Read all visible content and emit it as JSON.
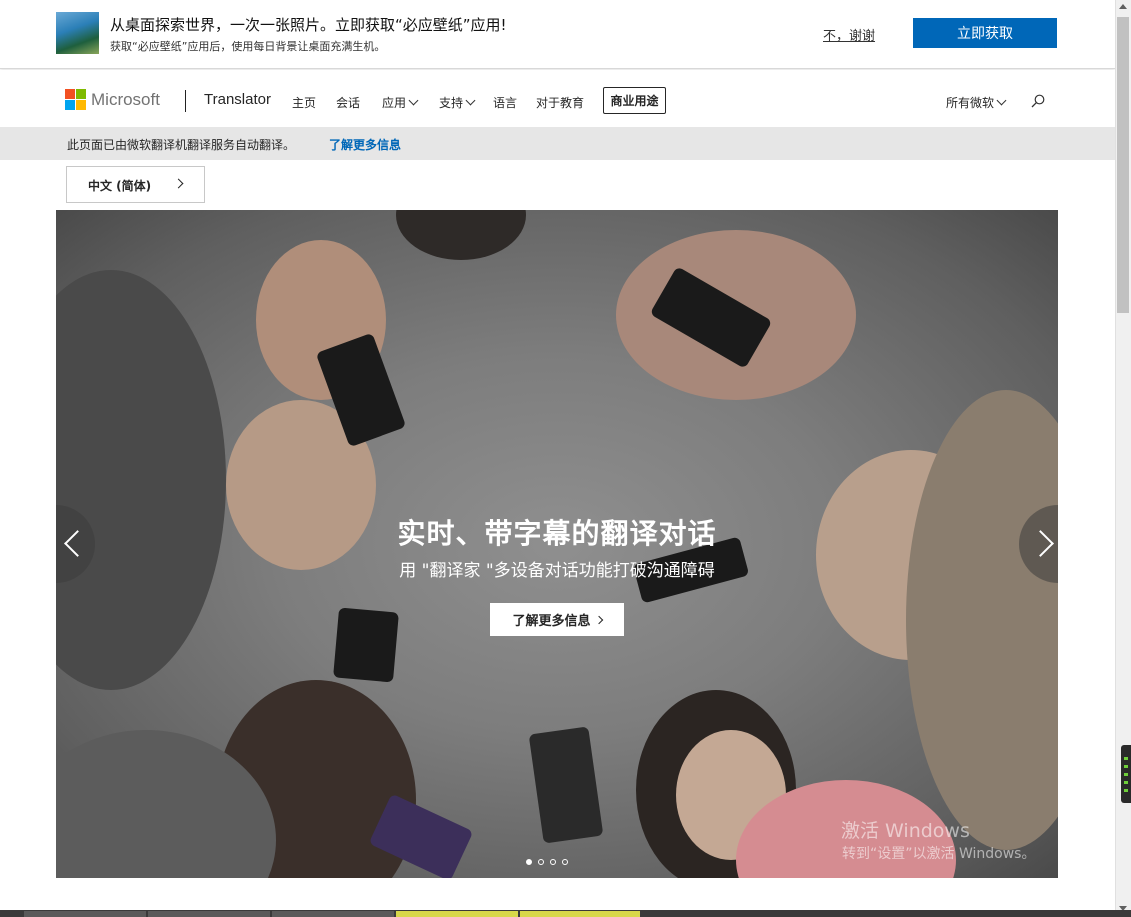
{
  "banner": {
    "title": "从桌面探索世界，一次一张照片。立即获取“必应壁纸”应用!",
    "subtitle": "获取“必应壁纸”应用后，使用每日背景让桌面充满生机。",
    "dismiss_label": "不，谢谢",
    "cta_label": "立即获取"
  },
  "header": {
    "brand": "Microsoft",
    "app_name": "Translator",
    "nav": [
      {
        "label": "主页"
      },
      {
        "label": "会话"
      },
      {
        "label": "应用"
      },
      {
        "label": "支持"
      },
      {
        "label": "语言"
      },
      {
        "label": "对于教育"
      }
    ],
    "business_label": "商业用途",
    "all_microsoft_label": "所有微软",
    "colors": {
      "red": "#f25022",
      "green": "#7fba00",
      "blue": "#00a4ef",
      "yellow": "#ffb900"
    }
  },
  "notice": {
    "text": "此页面已由微软翻译机翻译服务自动翻译。",
    "link": "了解更多信息"
  },
  "language": {
    "selected": "中文 (简体)"
  },
  "hero": {
    "title": "实时、带字幕的翻译对话",
    "subtitle": "用 \"翻译家 \"多设备对话功能打破沟通障碍",
    "cta_label": "了解更多信息",
    "slide_count": 4,
    "active_slide": 1
  },
  "watermark": {
    "line1": "激活 Windows",
    "line2": "转到“设置”以激活 Windows。"
  }
}
